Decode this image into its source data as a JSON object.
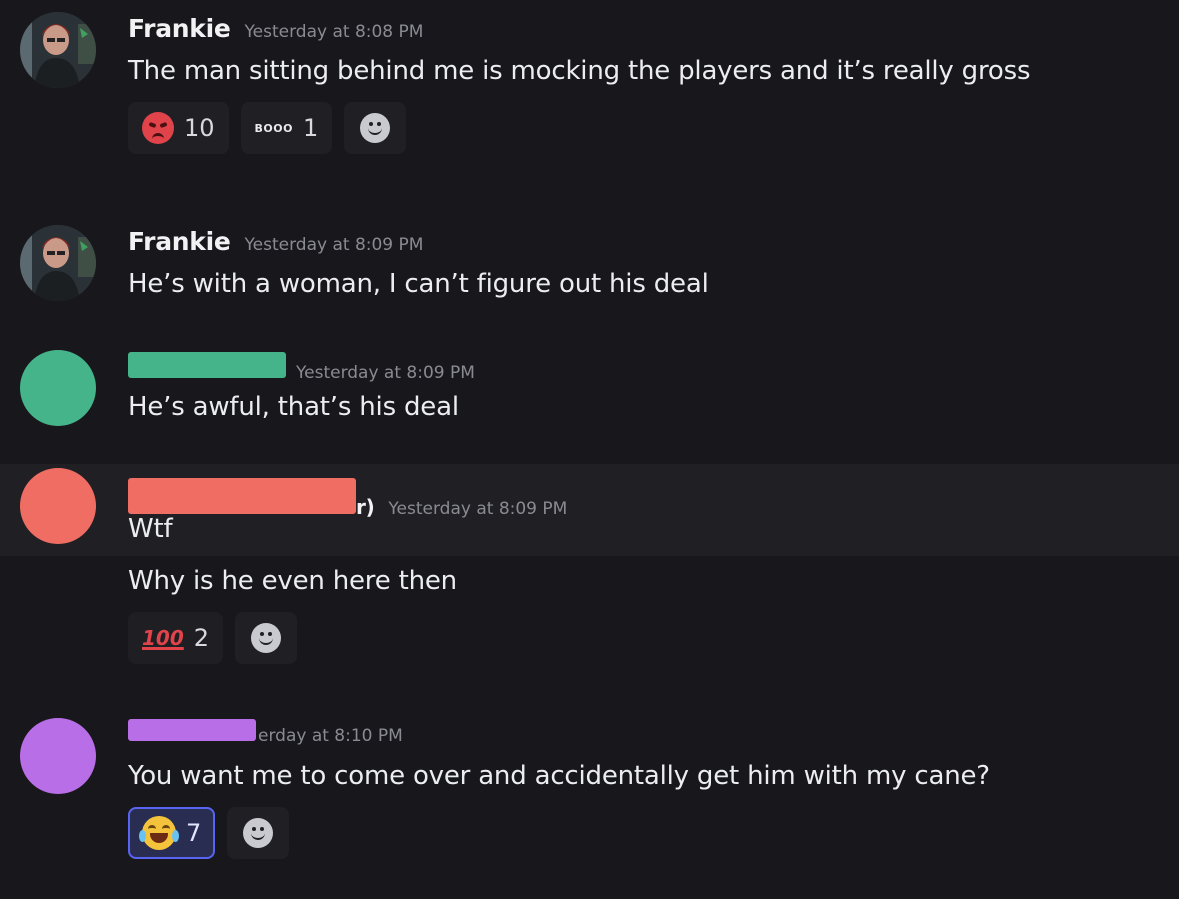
{
  "messages": [
    {
      "author": "Frankie",
      "timestamp": "Yesterday at 8:08 PM",
      "lines": [
        "The man sitting behind me is mocking the players and it’s really gross"
      ],
      "reactions": [
        {
          "emoji": "angry-face-icon",
          "count": "10"
        },
        {
          "emoji": "bonk-text-emoji",
          "label": "BOOO",
          "count": "1"
        }
      ]
    },
    {
      "author": "Frankie",
      "timestamp": "Yesterday at 8:09 PM",
      "lines": [
        "He’s with a woman, I can’t figure out his deal"
      ]
    },
    {
      "author_redacted_color": "#45b48a",
      "timestamp": "Yesterday at 8:09 PM",
      "lines": [
        "He’s awful, that’s his deal"
      ]
    },
    {
      "author_redacted_color": "#ef6d62",
      "author_suffix": "r)",
      "timestamp": "Yesterday at 8:09 PM",
      "lines": [
        "Wtf",
        "Why is he even here then"
      ],
      "reactions": [
        {
          "emoji": "hundred-points-icon",
          "label": "100",
          "count": "2"
        }
      ]
    },
    {
      "author_redacted_color": "#b86ee6",
      "timestamp": "erday at 8:10 PM",
      "lines": [
        "You want me to come over and accidentally get him with my cane?"
      ],
      "reactions": [
        {
          "emoji": "tears-of-joy-icon",
          "count": "7",
          "active": true
        }
      ]
    }
  ],
  "avatar_colors": {
    "m3": "#45b48a",
    "m4": "#ef6d62",
    "m5": "#b86ee6"
  }
}
